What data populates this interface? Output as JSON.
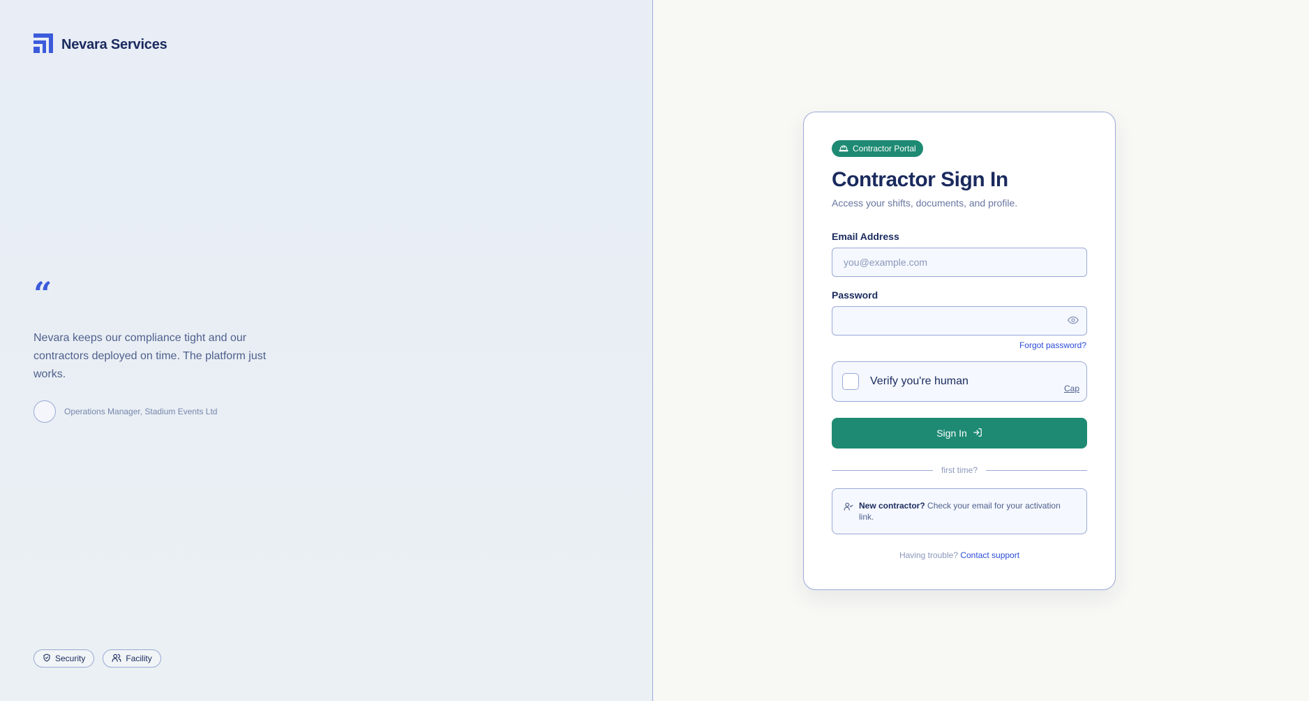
{
  "brand": {
    "name": "Nevara Services",
    "logo_icon": "stepped-square-logo-icon",
    "color": "#3b5bdb"
  },
  "testimonial": {
    "quote_mark": "“",
    "text": "Nevara keeps our compliance tight and our contractors deployed on time. The platform just works.",
    "author_role": "Operations Manager, Stadium Events Ltd"
  },
  "chips": [
    {
      "label": "Security",
      "icon": "shield-icon"
    },
    {
      "label": "Facility",
      "icon": "users-icon"
    }
  ],
  "card": {
    "badge": "Contractor Portal",
    "badge_icon": "hard-hat-icon",
    "title": "Contractor Sign In",
    "subtitle": "Access your shifts, documents, and profile.",
    "email": {
      "label": "Email Address",
      "placeholder": "you@example.com",
      "value": ""
    },
    "password": {
      "label": "Password",
      "value": ""
    },
    "forgot": "Forgot password?",
    "captcha": {
      "label": "Verify you're human",
      "link": "Cap"
    },
    "signin_label": "Sign In",
    "divider": "first time?",
    "info": {
      "bold": "New contractor?",
      "text": " Check your email for your activation link."
    },
    "trouble": {
      "text": "Having trouble?",
      "link": "Contact support"
    }
  },
  "colors": {
    "accent_green": "#1e8a73",
    "accent_blue": "#2a4bd7",
    "navy": "#1a2a5e",
    "border": "#9aa9d6"
  }
}
